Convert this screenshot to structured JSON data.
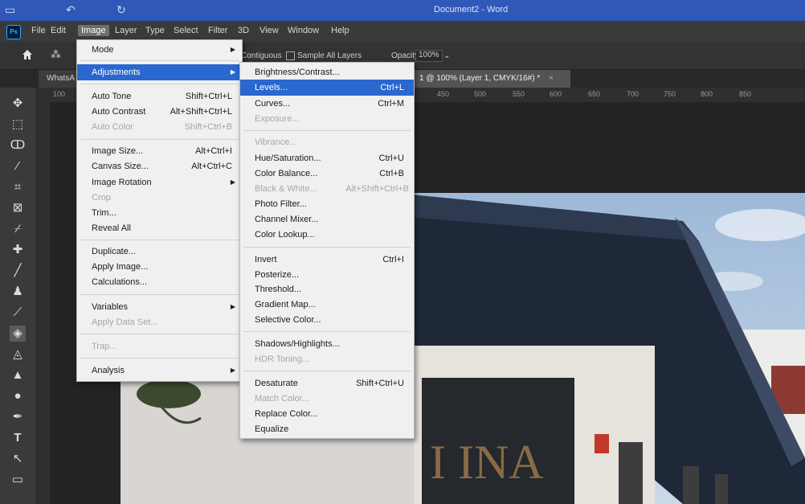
{
  "word": {
    "title": "Document2 - Word"
  },
  "menubar": {
    "logo": "Ps",
    "items": [
      "File",
      "Edit",
      "Image",
      "Layer",
      "Type",
      "Select",
      "Filter",
      "3D",
      "View",
      "Window",
      "Help"
    ]
  },
  "options": {
    "contiguous": "Contiguous",
    "sample_all_layers": "Sample All Layers",
    "opacity_label": "Opacity:",
    "opacity_value": "100%"
  },
  "tabs": {
    "left_tab": "WhatsA",
    "doc_tab": "1 @ 100% (Layer 1, CMYK/16#) *",
    "close": "×"
  },
  "ruler": {
    "ticks": [
      "100",
      "450",
      "500",
      "550",
      "600",
      "650",
      "700",
      "750",
      "800",
      "850"
    ]
  },
  "image_menu": {
    "rows": [
      {
        "label": "Mode",
        "shortcut": "",
        "submenu": true,
        "disabled": false,
        "highlight": false
      },
      {
        "label": "Adjustments",
        "shortcut": "",
        "submenu": true,
        "disabled": false,
        "highlight": true
      },
      {
        "label": "Auto Tone",
        "shortcut": "Shift+Ctrl+L",
        "submenu": false,
        "disabled": false,
        "highlight": false
      },
      {
        "label": "Auto Contrast",
        "shortcut": "Alt+Shift+Ctrl+L",
        "submenu": false,
        "disabled": false,
        "highlight": false
      },
      {
        "label": "Auto Color",
        "shortcut": "Shift+Ctrl+B",
        "submenu": false,
        "disabled": true,
        "highlight": false
      },
      {
        "label": "Image Size...",
        "shortcut": "Alt+Ctrl+I",
        "submenu": false,
        "disabled": false,
        "highlight": false
      },
      {
        "label": "Canvas Size...",
        "shortcut": "Alt+Ctrl+C",
        "submenu": false,
        "disabled": false,
        "highlight": false
      },
      {
        "label": "Image Rotation",
        "shortcut": "",
        "submenu": true,
        "disabled": false,
        "highlight": false
      },
      {
        "label": "Crop",
        "shortcut": "",
        "submenu": false,
        "disabled": true,
        "highlight": false
      },
      {
        "label": "Trim...",
        "shortcut": "",
        "submenu": false,
        "disabled": false,
        "highlight": false
      },
      {
        "label": "Reveal All",
        "shortcut": "",
        "submenu": false,
        "disabled": false,
        "highlight": false
      },
      {
        "label": "Duplicate...",
        "shortcut": "",
        "submenu": false,
        "disabled": false,
        "highlight": false
      },
      {
        "label": "Apply Image...",
        "shortcut": "",
        "submenu": false,
        "disabled": false,
        "highlight": false
      },
      {
        "label": "Calculations...",
        "shortcut": "",
        "submenu": false,
        "disabled": false,
        "highlight": false
      },
      {
        "label": "Variables",
        "shortcut": "",
        "submenu": true,
        "disabled": false,
        "highlight": false
      },
      {
        "label": "Apply Data Set...",
        "shortcut": "",
        "submenu": false,
        "disabled": true,
        "highlight": false
      },
      {
        "label": "Trap...",
        "shortcut": "",
        "submenu": false,
        "disabled": true,
        "highlight": false
      },
      {
        "label": "Analysis",
        "shortcut": "",
        "submenu": true,
        "disabled": false,
        "highlight": false
      }
    ]
  },
  "adjust_menu": {
    "rows": [
      {
        "label": "Brightness/Contrast...",
        "shortcut": "",
        "disabled": false,
        "highlight": false
      },
      {
        "label": "Levels...",
        "shortcut": "Ctrl+L",
        "disabled": false,
        "highlight": true
      },
      {
        "label": "Curves...",
        "shortcut": "Ctrl+M",
        "disabled": false,
        "highlight": false
      },
      {
        "label": "Exposure...",
        "shortcut": "",
        "disabled": true,
        "highlight": false
      },
      {
        "label": "Vibrance...",
        "shortcut": "",
        "disabled": true,
        "highlight": false
      },
      {
        "label": "Hue/Saturation...",
        "shortcut": "Ctrl+U",
        "disabled": false,
        "highlight": false
      },
      {
        "label": "Color Balance...",
        "shortcut": "Ctrl+B",
        "disabled": false,
        "highlight": false
      },
      {
        "label": "Black & White...",
        "shortcut": "Alt+Shift+Ctrl+B",
        "disabled": true,
        "highlight": false
      },
      {
        "label": "Photo Filter...",
        "shortcut": "",
        "disabled": false,
        "highlight": false
      },
      {
        "label": "Channel Mixer...",
        "shortcut": "",
        "disabled": false,
        "highlight": false
      },
      {
        "label": "Color Lookup...",
        "shortcut": "",
        "disabled": false,
        "highlight": false
      },
      {
        "label": "Invert",
        "shortcut": "Ctrl+I",
        "disabled": false,
        "highlight": false
      },
      {
        "label": "Posterize...",
        "shortcut": "",
        "disabled": false,
        "highlight": false
      },
      {
        "label": "Threshold...",
        "shortcut": "",
        "disabled": false,
        "highlight": false
      },
      {
        "label": "Gradient Map...",
        "shortcut": "",
        "disabled": false,
        "highlight": false
      },
      {
        "label": "Selective Color...",
        "shortcut": "",
        "disabled": false,
        "highlight": false
      },
      {
        "label": "Shadows/Highlights...",
        "shortcut": "",
        "disabled": false,
        "highlight": false
      },
      {
        "label": "HDR Toning...",
        "shortcut": "",
        "disabled": true,
        "highlight": false
      },
      {
        "label": "Desaturate",
        "shortcut": "Shift+Ctrl+U",
        "disabled": false,
        "highlight": false
      },
      {
        "label": "Match Color...",
        "shortcut": "",
        "disabled": true,
        "highlight": false
      },
      {
        "label": "Replace Color...",
        "shortcut": "",
        "disabled": false,
        "highlight": false
      },
      {
        "label": "Equalize",
        "shortcut": "",
        "disabled": false,
        "highlight": false
      }
    ]
  },
  "colors": {
    "highlight": "#2a67cf",
    "ps_blue": "#31a8ff",
    "word_blue": "#2f58b8"
  }
}
